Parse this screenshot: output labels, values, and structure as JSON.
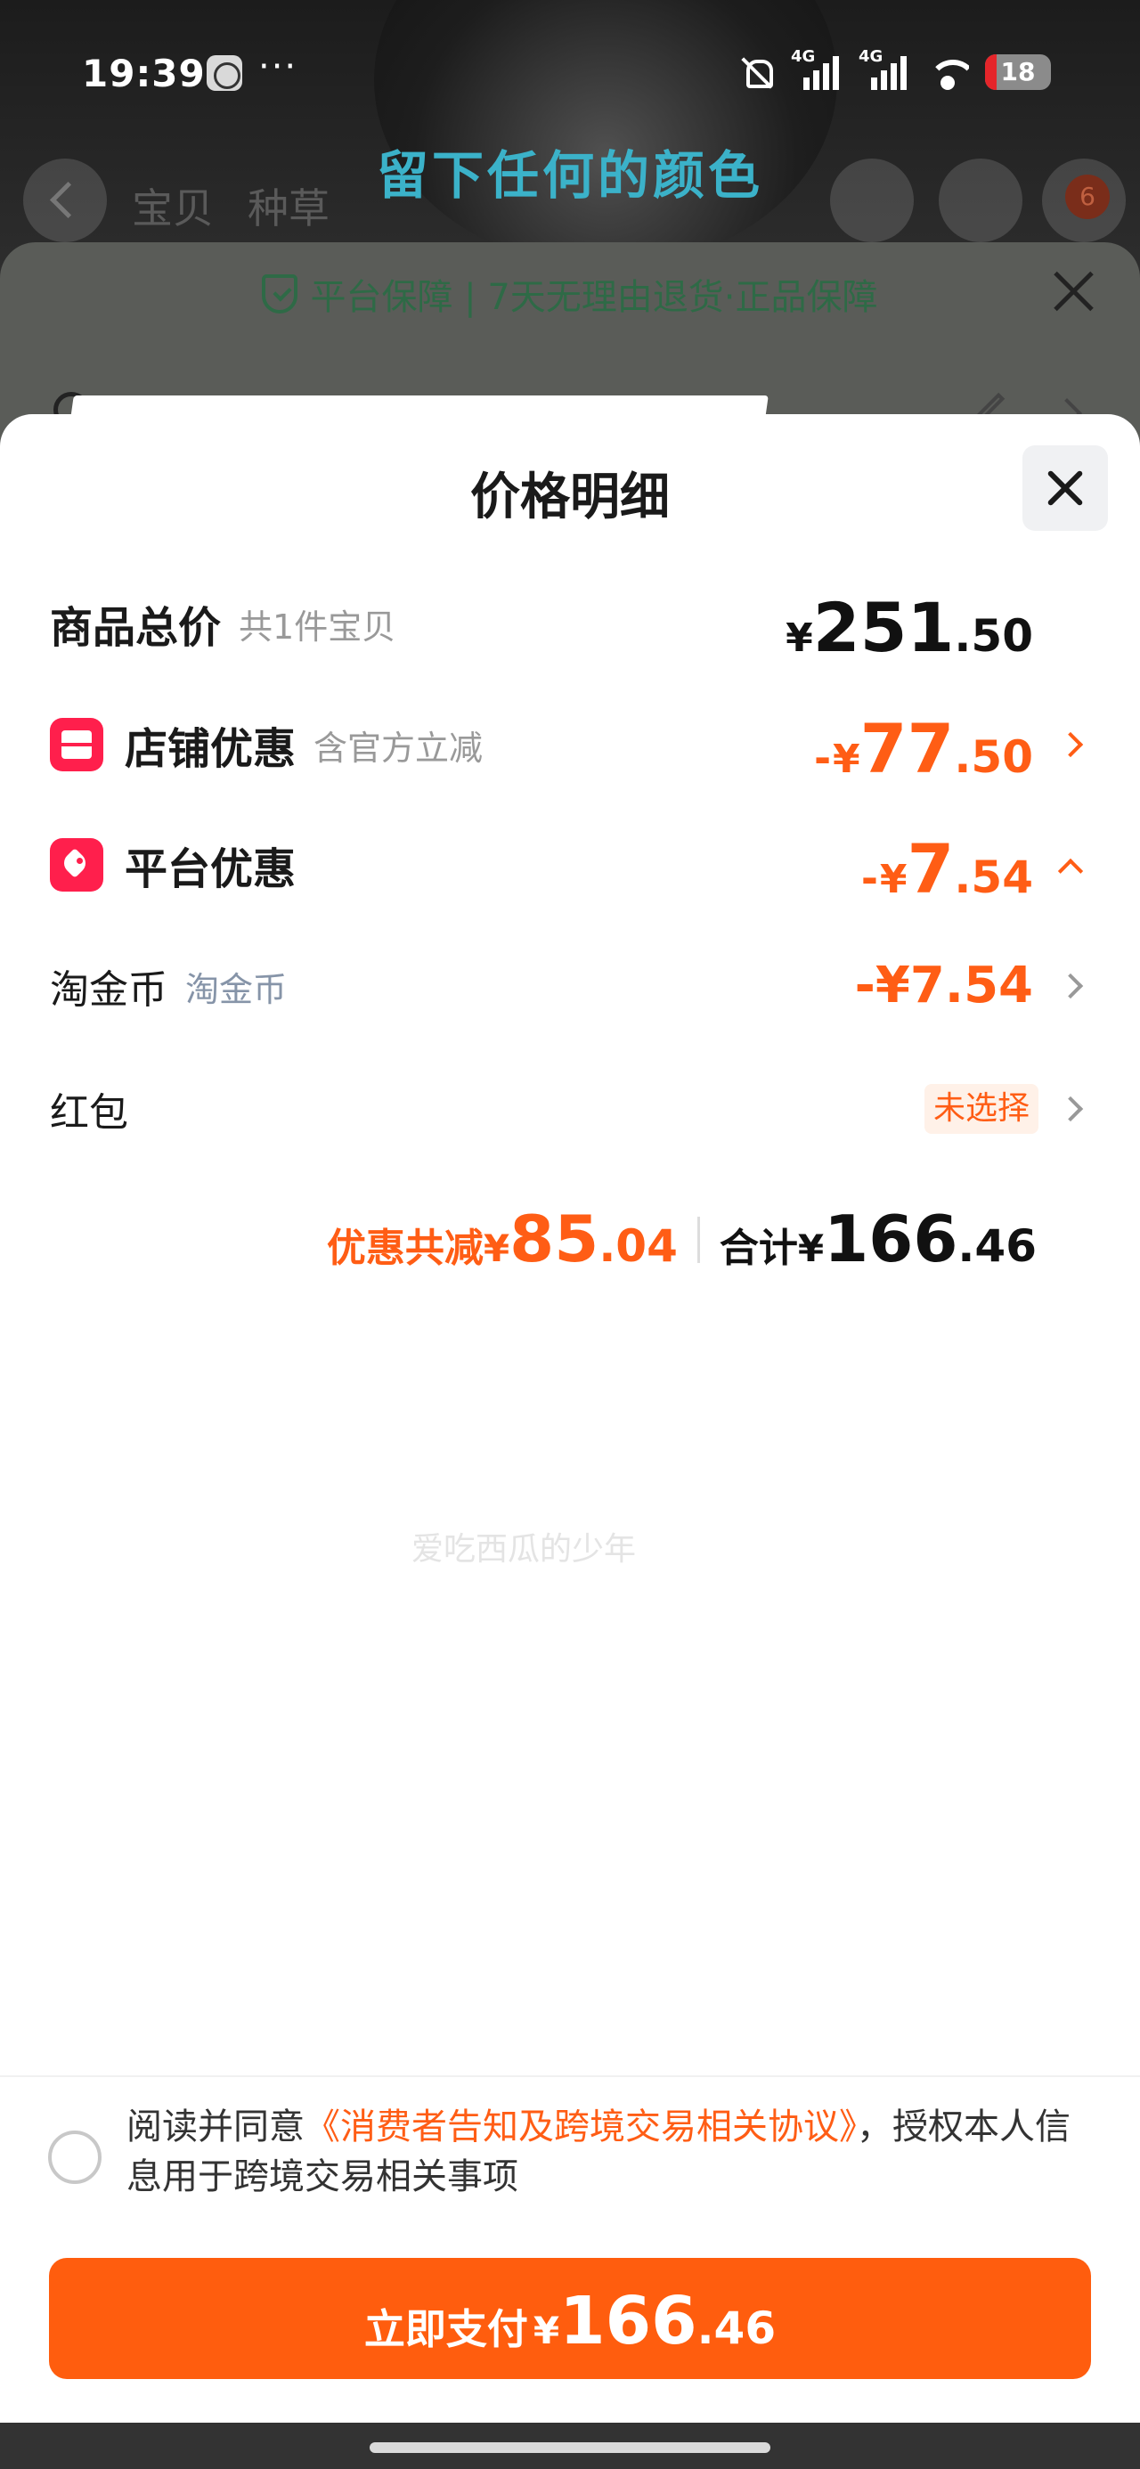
{
  "status_bar": {
    "time": "19:39",
    "more": "···",
    "signal_1": "4G",
    "signal_2": "4G",
    "battery": "18",
    "battery_level": 0.18,
    "icons": [
      "compass-icon",
      "mute-bell-icon",
      "signal-icon",
      "wifi-icon",
      "battery-icon"
    ]
  },
  "background_page": {
    "video_title": "留下任何的颜色",
    "tabs": [
      "宝贝",
      "种草"
    ],
    "cart_badge": "6",
    "guarantee_text": "平台保障 | 7天无理由退货·正品保障"
  },
  "price_sheet": {
    "title": "价格明细",
    "rows": {
      "total": {
        "label": "商品总价",
        "sub": "共1件宝贝",
        "yen": "¥",
        "int": "251",
        "dec": ".50"
      },
      "store": {
        "label": "店铺优惠",
        "sub": "含官方立减",
        "sign": "-",
        "yen": "¥",
        "int": "77",
        "dec": ".50"
      },
      "platform": {
        "label": "平台优惠",
        "sign": "-",
        "yen": "¥",
        "int": "7",
        "dec": ".54"
      },
      "coins": {
        "label": "淘金币",
        "sub": "淘金币",
        "amount": "-¥7.54"
      },
      "red_packet": {
        "label": "红包",
        "value": "未选择"
      }
    },
    "watermark": "爱吃西瓜的少年",
    "summary": {
      "discount_label": "优惠共减",
      "discount_yen": "¥",
      "discount_int": "85",
      "discount_dec": ".04",
      "total_label": "合计",
      "total_yen": "¥",
      "total_int": "166",
      "total_dec": ".46"
    },
    "agreement": {
      "prefix": "阅读并同意",
      "link": "《消费者告知及跨境交易相关协议》",
      "suffix": "，授权本人信息用于跨境交易相关事项"
    },
    "pay_button": {
      "label": "立即支付",
      "yen": "¥",
      "int": "166",
      "dec": ".46"
    }
  },
  "colors": {
    "accent": "#ff5d15",
    "pay_button": "#ff5d0e",
    "icon_red": "#ff1f4c",
    "title_cyan": "#3bb2c9",
    "guarantee_green": "#2e6a46"
  }
}
